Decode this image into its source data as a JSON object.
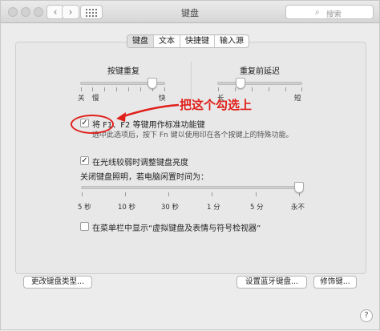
{
  "window": {
    "title": "键盘"
  },
  "search": {
    "placeholder": "搜索",
    "icon": "search-icon"
  },
  "tabs": [
    {
      "label": "键盘",
      "active": true
    },
    {
      "label": "文本",
      "active": false
    },
    {
      "label": "快捷键",
      "active": false
    },
    {
      "label": "输入源",
      "active": false
    }
  ],
  "repeat": {
    "title": "按键重复",
    "min_label": "关",
    "slow_label": "慢",
    "fast_label": "快",
    "level": 0.85
  },
  "delay": {
    "title": "重复前延迟",
    "long_label": "长",
    "short_label": "短",
    "level": 0.27
  },
  "fn_option": {
    "label": "将 F1、F2 等键用作标准功能键",
    "checked": true,
    "description": "选中此选项后，按下 Fn 键以使用印在各个按键上的特殊功能。"
  },
  "brightness_option": {
    "label": "在光线较弱时调整键盘亮度",
    "checked": true
  },
  "backlight": {
    "title": "关闭键盘照明，若电脑闲置时间为：",
    "ticks": [
      "5 秒",
      "10 秒",
      "30 秒",
      "1 分",
      "5 分",
      "永不"
    ],
    "selected": "永不"
  },
  "viewer_option": {
    "label": "在菜单栏中显示“虚拟键盘及表情与符号检视器”",
    "checked": false
  },
  "buttons": {
    "change_type": "更改键盘类型...",
    "bluetooth": "设置蓝牙键盘...",
    "modifier": "修饰键..."
  },
  "help": "?",
  "annotation": {
    "text": "把这个勾选上",
    "color": "#e0201b"
  }
}
